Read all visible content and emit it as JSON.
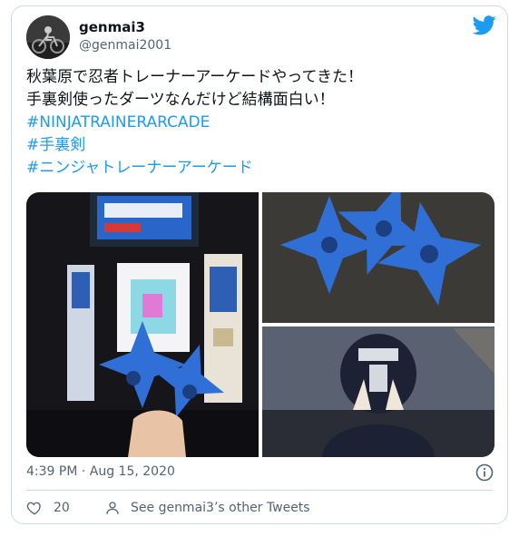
{
  "tweet": {
    "display_name": "genmai3",
    "handle": "@genmai2001",
    "lines": [
      "秋葉原で忍者トレーナーアーケードやってきた！",
      "手裏剣使ったダーツなんだけど結構面白い！"
    ],
    "hashtags": [
      "#NINJATRAINERARCADE",
      "#手裏剣",
      "#ニンジャトレーナーアーケード"
    ],
    "timestamp": "4:39 PM · Aug 15, 2020",
    "like_count": "20",
    "see_more": "See genmai3’s other Tweets"
  },
  "icons": {
    "brand": "twitter-bird-icon",
    "info": "info-icon",
    "like": "heart-icon",
    "profile": "person-icon"
  },
  "colors": {
    "accent": "#1d9bf0",
    "text": "#0f1419",
    "secondary": "#536471",
    "border": "#cfd9de",
    "shuriken_blue": "#2f6fd6"
  }
}
